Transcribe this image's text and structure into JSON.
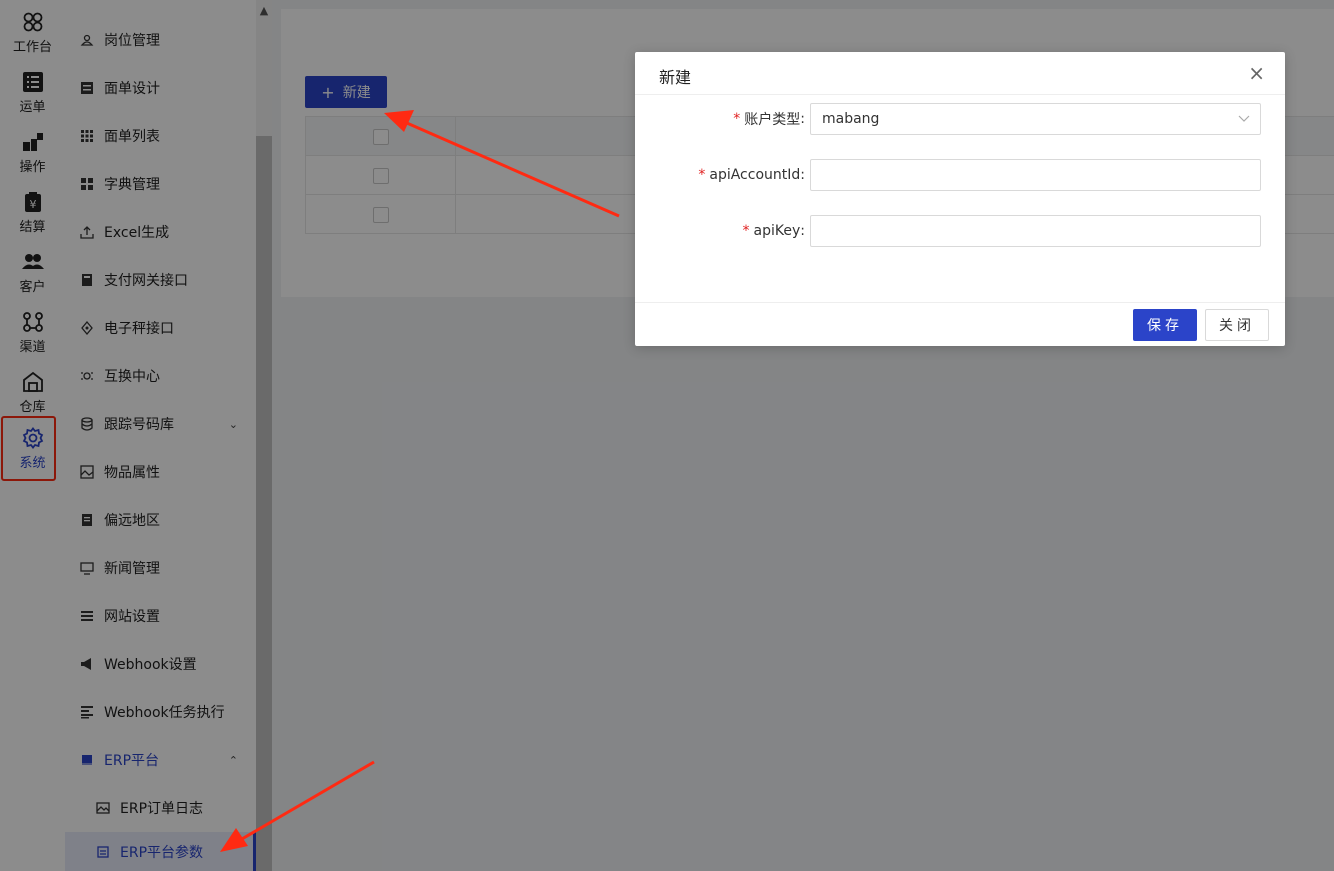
{
  "colors": {
    "accent": "#2b44c9",
    "annotation": "#ff2a12"
  },
  "rail": {
    "items": [
      {
        "label": "工作台",
        "icon": "workbench-icon"
      },
      {
        "label": "运单",
        "icon": "waybill-icon"
      },
      {
        "label": "操作",
        "icon": "operation-icon"
      },
      {
        "label": "结算",
        "icon": "settlement-icon"
      },
      {
        "label": "客户",
        "icon": "customer-icon"
      },
      {
        "label": "渠道",
        "icon": "channel-icon"
      },
      {
        "label": "仓库",
        "icon": "warehouse-icon"
      },
      {
        "label": "系统",
        "icon": "gear-icon"
      }
    ]
  },
  "submenu": {
    "items": [
      {
        "label": "岗位管理"
      },
      {
        "label": "面单设计"
      },
      {
        "label": "面单列表"
      },
      {
        "label": "字典管理"
      },
      {
        "label": "Excel生成"
      },
      {
        "label": "支付网关接口"
      },
      {
        "label": "电子秤接口"
      },
      {
        "label": "互换中心"
      },
      {
        "label": "跟踪号码库"
      },
      {
        "label": "物品属性"
      },
      {
        "label": "偏远地区"
      },
      {
        "label": "新闻管理"
      },
      {
        "label": "网站设置"
      },
      {
        "label": "Webhook设置"
      },
      {
        "label": "Webhook任务执行"
      },
      {
        "label": "ERP平台"
      },
      {
        "label": "ERP订单日志"
      },
      {
        "label": "ERP平台参数"
      }
    ]
  },
  "toolbar": {
    "new_label": "新建"
  },
  "dialog": {
    "title": "新建",
    "fields": [
      {
        "label": "账户类型",
        "value": "mabang"
      },
      {
        "label": "apiAccountId",
        "value": ""
      },
      {
        "label": "apiKey",
        "value": ""
      }
    ],
    "colon": ":",
    "required_mark": "*",
    "save_label": "保存",
    "close_label": "关闭",
    "close_icon": "×"
  }
}
